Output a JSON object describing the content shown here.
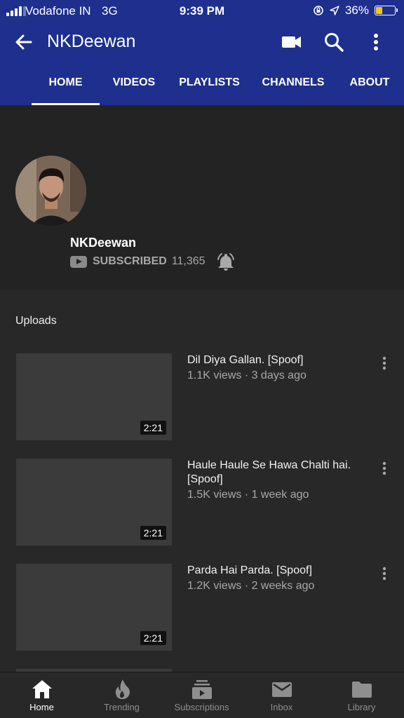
{
  "status_bar": {
    "carrier": "Vodafone IN",
    "network": "3G",
    "time": "9:39 PM",
    "battery_text": "36%",
    "battery_level": 0.36
  },
  "app_bar": {
    "title": "NKDeewan",
    "icons": [
      "back-arrow-icon",
      "video-camera-icon",
      "search-icon",
      "more-vert-icon"
    ],
    "background_color": "#1e2f8e"
  },
  "tabs": [
    {
      "label": "HOME",
      "active": true
    },
    {
      "label": "VIDEOS",
      "active": false
    },
    {
      "label": "PLAYLISTS",
      "active": false
    },
    {
      "label": "CHANNELS",
      "active": false
    },
    {
      "label": "ABOUT",
      "active": false
    }
  ],
  "channel": {
    "name": "NKDeewan",
    "subscribed_label": "SUBSCRIBED",
    "subscriber_count": "11,365"
  },
  "uploads": {
    "title": "Uploads",
    "videos": [
      {
        "title": "Dil Diya Gallan. [Spoof]",
        "meta": "1.1K views · 3 days ago",
        "duration": "2:21"
      },
      {
        "title": "Haule Haule Se Hawa Chalti hai. [Spoof]",
        "meta": "1.5K views · 1 week ago",
        "duration": "2:21"
      },
      {
        "title": "Parda Hai Parda. [Spoof]",
        "meta": "1.2K views · 2 weeks ago",
        "duration": "2:21"
      }
    ]
  },
  "bottom_nav": [
    {
      "label": "Home",
      "icon": "home-icon",
      "active": true
    },
    {
      "label": "Trending",
      "icon": "flame-icon",
      "active": false
    },
    {
      "label": "Subscriptions",
      "icon": "subscriptions-icon",
      "active": false
    },
    {
      "label": "Inbox",
      "icon": "mail-icon",
      "active": false
    },
    {
      "label": "Library",
      "icon": "folder-icon",
      "active": false
    }
  ]
}
